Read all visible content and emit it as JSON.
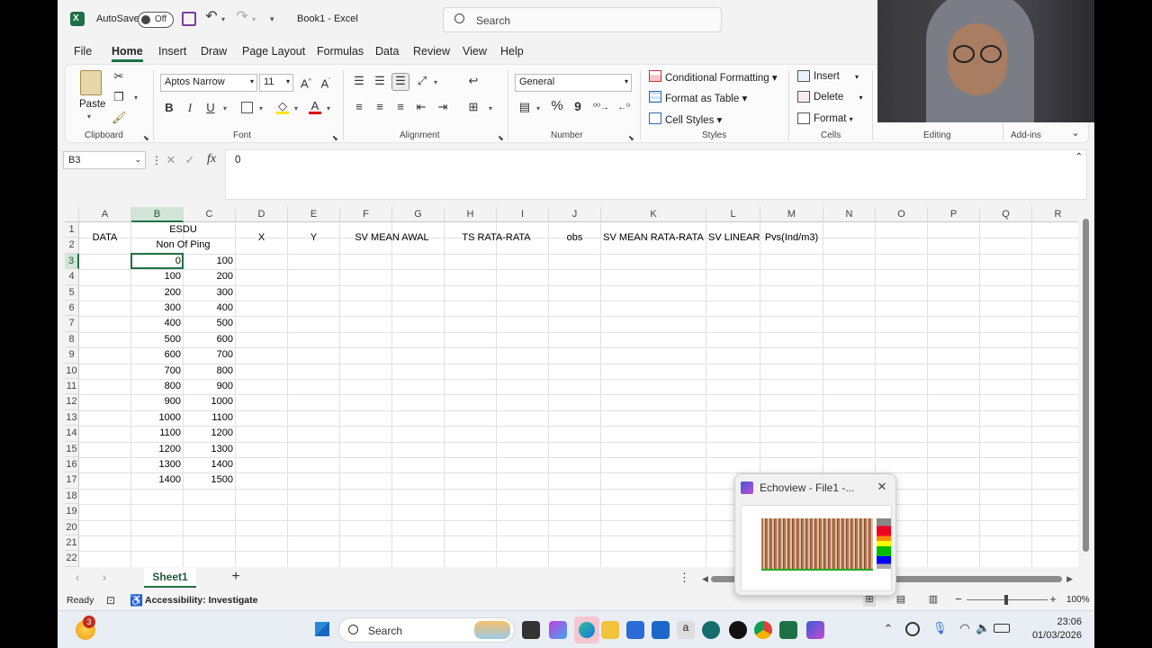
{
  "titlebar": {
    "autosave_label": "AutoSave",
    "autosave_state": "Off",
    "title": "Book1  -  Excel",
    "search_placeholder": "Search"
  },
  "menu": [
    "File",
    "Home",
    "Insert",
    "Draw",
    "Page Layout",
    "Formulas",
    "Data",
    "Review",
    "View",
    "Help"
  ],
  "ribbon": {
    "clipboard": {
      "paste": "Paste",
      "label": "Clipboard"
    },
    "font": {
      "font_name": "Aptos Narrow",
      "font_size": "11",
      "bold": "B",
      "italic": "I",
      "underline": "U",
      "label": "Font"
    },
    "alignment": {
      "label": "Alignment"
    },
    "number": {
      "format": "General",
      "percent": "%",
      "comma": "9",
      "label": "Number"
    },
    "styles": {
      "conditional": "Conditional Formatting",
      "format_table": "Format as Table",
      "cell_styles": "Cell Styles",
      "label": "Styles"
    },
    "cells": {
      "insert": "Insert",
      "delete": "Delete",
      "format": "Format",
      "label": "Cells"
    },
    "editing": {
      "label": "Editing"
    },
    "addins": {
      "label": "Add-ins"
    }
  },
  "formula_bar": {
    "name_box": "B3",
    "fx": "fx",
    "value": "0"
  },
  "grid": {
    "columns": [
      "A",
      "B",
      "C",
      "D",
      "E",
      "F",
      "G",
      "H",
      "I",
      "J",
      "K",
      "L",
      "M",
      "N",
      "O",
      "P",
      "Q",
      "R"
    ],
    "rows": [
      "1",
      "2",
      "3",
      "4",
      "5",
      "6",
      "7",
      "8",
      "9",
      "10",
      "11",
      "12",
      "13",
      "14",
      "15",
      "16",
      "17",
      "18",
      "19",
      "20",
      "21",
      "22"
    ],
    "headers": {
      "data": "DATA",
      "esdu": "ESDU",
      "non_of_ping": "Non Of Ping",
      "x": "X",
      "y": "Y",
      "sv_mean_awal": "SV MEAN AWAL",
      "ts_rata": "TS RATA-RATA",
      "obs": "obs",
      "sv_mean_rata": "SV MEAN RATA-RATA",
      "sv_linear": "SV LINEAR",
      "pvs": "Pvs(Ind/m3)"
    },
    "col_b": [
      "0",
      "100",
      "200",
      "300",
      "400",
      "500",
      "600",
      "700",
      "800",
      "900",
      "1000",
      "1100",
      "1200",
      "1300",
      "1400"
    ],
    "col_c": [
      "100",
      "200",
      "300",
      "400",
      "500",
      "600",
      "700",
      "800",
      "900",
      "1000",
      "1100",
      "1200",
      "1300",
      "1400",
      "1500"
    ]
  },
  "sheets": {
    "active": "Sheet1",
    "add": "+"
  },
  "status": {
    "ready": "Ready",
    "accessibility": "Accessibility: Investigate",
    "zoom": "100%"
  },
  "popup": {
    "title": "Echoview - File1 -..."
  },
  "taskbar": {
    "search": "Search",
    "time": "23:06",
    "date": "01/03/2026",
    "badge": "3"
  },
  "colors": {
    "excel_green": "#1e7145",
    "selection": "#1e7145"
  }
}
